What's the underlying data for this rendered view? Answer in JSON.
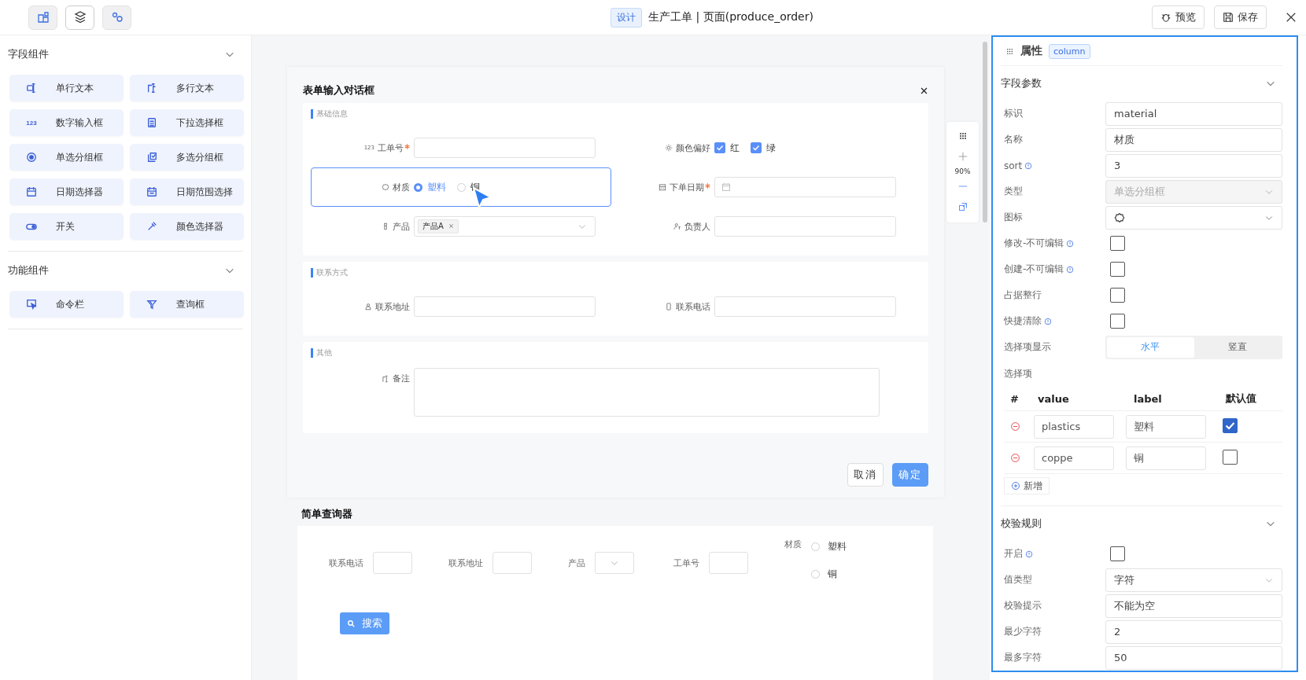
{
  "toolbar": [
    {
      "selected": false
    },
    {
      "selected": true
    },
    {
      "selected": false
    }
  ],
  "header": {
    "mode": "设计",
    "title": "生产工单 | 页面(produce_order)",
    "actions": [
      {
        "label": "预览"
      },
      {
        "label": "保存"
      }
    ]
  },
  "palette": [
    {
      "title": "字段组件",
      "expanded": true,
      "items": [
        {
          "label": "单行文本"
        },
        {
          "label": "多行文本"
        },
        {
          "label": "数字输入框",
          "glyph": "123"
        },
        {
          "label": "下拉选择框"
        },
        {
          "label": "单选分组框"
        },
        {
          "label": "多选分组框"
        },
        {
          "label": "日期选择器"
        },
        {
          "label": "日期范围选择"
        },
        {
          "label": "开关"
        },
        {
          "label": "颜色选择器"
        }
      ]
    },
    {
      "title": "功能组件",
      "expanded": true,
      "items": [
        {
          "label": "命令栏"
        },
        {
          "label": "查询框"
        }
      ]
    }
  ],
  "dialog": {
    "title": "表单输入对话框",
    "sections": [
      {
        "title": "基础信息",
        "fields": [
          {
            "kind": "number",
            "glyph": "123",
            "label": "工单号",
            "required": true,
            "selected": false
          },
          {
            "kind": "checkbox",
            "label": "颜色偏好",
            "required": false,
            "selected": false,
            "options": [
              {
                "label": "红",
                "checked": true
              },
              {
                "label": "绿",
                "checked": true
              }
            ]
          },
          {
            "kind": "radio",
            "label": "材质",
            "required": false,
            "selected": true,
            "options": [
              {
                "label": "塑料",
                "selected": true
              },
              {
                "label": "铜",
                "selected": false
              }
            ]
          },
          {
            "kind": "date",
            "label": "下单日期",
            "required": true,
            "selected": false
          },
          {
            "kind": "select",
            "label": "产品",
            "required": false,
            "selected": false,
            "tags": [
              "产品A"
            ]
          },
          {
            "kind": "user",
            "label": "负责人",
            "required": false,
            "selected": false
          }
        ]
      },
      {
        "title": "联系方式",
        "fields": [
          {
            "kind": "address",
            "label": "联系地址",
            "required": false,
            "selected": false
          },
          {
            "kind": "phone",
            "label": "联系电话",
            "required": false,
            "selected": false
          }
        ]
      },
      {
        "title": "其他",
        "fields": [
          {
            "kind": "textarea",
            "label": "备注",
            "required": false,
            "selected": false
          }
        ]
      }
    ],
    "buttons": [
      {
        "label": "取消",
        "kind": "default"
      },
      {
        "label": "确定",
        "kind": "primary"
      }
    ]
  },
  "zoom": {
    "value": "90%"
  },
  "query": {
    "title": "简单查询器",
    "fields": [
      {
        "kind": "text",
        "label": "联系电话"
      },
      {
        "kind": "text",
        "label": "联系地址"
      },
      {
        "kind": "select",
        "label": "产品"
      },
      {
        "kind": "text",
        "label": "工单号"
      },
      {
        "kind": "radio",
        "label": "材质",
        "options": [
          {
            "label": "塑料",
            "selected": false
          },
          {
            "label": "铜",
            "selected": false
          }
        ]
      }
    ],
    "button": "搜索"
  },
  "properties": {
    "title": "属性",
    "tag": "column",
    "sections": [
      {
        "title": "字段参数",
        "expanded": true,
        "rows": [
          {
            "kind": "input",
            "label": "标识",
            "value": "material"
          },
          {
            "kind": "input",
            "label": "名称",
            "value": "材质"
          },
          {
            "kind": "input",
            "label": "sort",
            "info": true,
            "value": "3"
          },
          {
            "kind": "select",
            "label": "类型",
            "value": "单选分组框",
            "disabled": true
          },
          {
            "kind": "icon-select",
            "label": "图标"
          },
          {
            "kind": "checkbox",
            "label": "修改-不可编辑",
            "info": true,
            "checked": false
          },
          {
            "kind": "checkbox",
            "label": "创建-不可编辑",
            "info": true,
            "checked": false
          },
          {
            "kind": "checkbox",
            "label": "占据整行",
            "checked": false
          },
          {
            "kind": "checkbox",
            "label": "快捷清除",
            "info": true,
            "checked": false
          },
          {
            "kind": "segmented",
            "label": "选择项显示",
            "options": [
              {
                "label": "水平",
                "selected": true
              },
              {
                "label": "竖直",
                "selected": false
              }
            ]
          },
          {
            "kind": "options",
            "label": "选择项",
            "columns": [
              "#",
              "value",
              "label",
              "默认值"
            ],
            "items": [
              {
                "value": "plastics",
                "label": "塑料",
                "checked": true
              },
              {
                "value": "coppe",
                "label": "铜",
                "checked": false
              }
            ],
            "add": "新增"
          }
        ]
      },
      {
        "title": "校验规则",
        "expanded": true,
        "rows": [
          {
            "kind": "checkbox",
            "label": "开启",
            "info": true,
            "checked": false
          },
          {
            "kind": "select",
            "label": "值类型",
            "value": "字符",
            "disabled": false
          },
          {
            "kind": "input",
            "label": "校验提示",
            "value": "不能为空"
          },
          {
            "kind": "input",
            "label": "最少字符",
            "value": "2"
          },
          {
            "kind": "input",
            "label": "最多字符",
            "value": "50"
          }
        ]
      }
    ]
  }
}
